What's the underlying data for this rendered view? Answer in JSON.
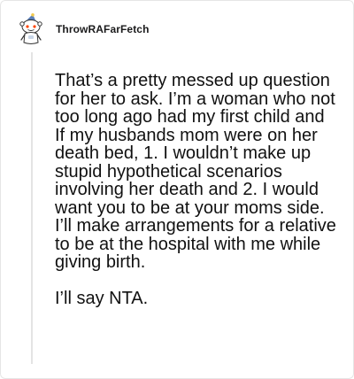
{
  "comment": {
    "username": "ThrowRAFarFetch",
    "avatar_icon": "reddit-snoo-avatar-icon",
    "paragraphs": [
      "That’s a pretty messed up question for her to ask. I’m a woman who not too long ago had my first child and If my husbands mom were on her death bed, 1. I wouldn’t make up stupid hypothetical scenarios involving her death and 2. I would want you to be at your moms side. I’ll make arrangements for a relative to be at the hospital with me while giving birth.",
      "I’ll say NTA."
    ]
  },
  "colors": {
    "text": "#111111",
    "username": "#1a1a1b",
    "thread_line": "#e4e4e4",
    "card_border": "#e6e6e6",
    "avatar_accent": "#0079d3"
  }
}
